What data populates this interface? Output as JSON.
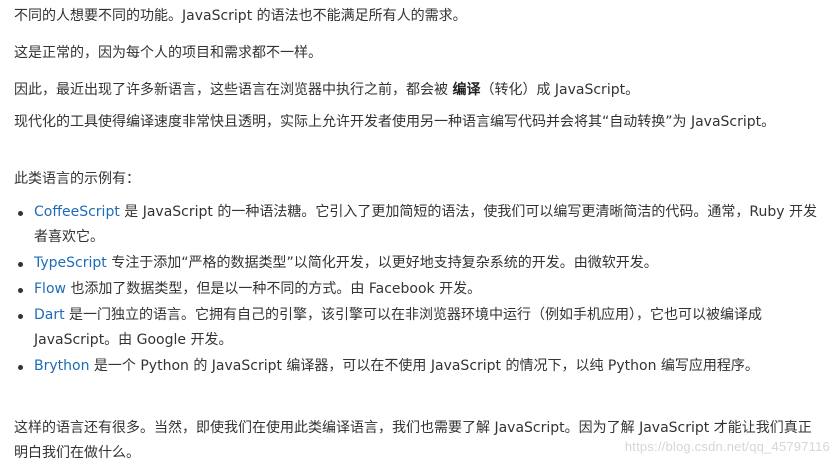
{
  "paragraphs": {
    "p1": "不同的人想要不同的功能。JavaScript 的语法也不能满足所有人的需求。",
    "p2": "这是正常的，因为每个人的项目和需求都不一样。",
    "p3_before": "因此，最近出现了许多新语言，这些语言在浏览器中执行之前，都会被 ",
    "p3_bold": "编译",
    "p3_after": "（转化）成 JavaScript。",
    "p4": "现代化的工具使得编译速度非常快且透明，实际上允许开发者使用另一种语言编写代码并会将其“自动转换”为 JavaScript。",
    "p5": "此类语言的示例有：",
    "p6": "这样的语言还有很多。当然，即使我们在使用此类编译语言，我们也需要了解 JavaScript。因为了解 JavaScript 才能让我们真正明白我们在做什么。"
  },
  "languages": [
    {
      "name": "CoffeeScript",
      "desc": " 是 JavaScript 的一种语法糖。它引入了更加简短的语法，使我们可以编写更清晰简洁的代码。通常，Ruby 开发者喜欢它。"
    },
    {
      "name": "TypeScript",
      "desc": " 专注于添加“严格的数据类型”以简化开发，以更好地支持复杂系统的开发。由微软开发。"
    },
    {
      "name": "Flow",
      "desc": " 也添加了数据类型，但是以一种不同的方式。由 Facebook 开发。"
    },
    {
      "name": "Dart",
      "desc": " 是一门独立的语言。它拥有自己的引擎，该引擎可以在非浏览器环境中运行（例如手机应用），它也可以被编译成 JavaScript。由 Google 开发。"
    },
    {
      "name": "Brython",
      "desc": " 是一个 Python 的 JavaScript 编译器，可以在不使用 JavaScript 的情况下，以纯 Python 编写应用程序。"
    }
  ],
  "watermark": "https://blog.csdn.net/qq_45797116",
  "colors": {
    "text": "#333333",
    "link": "#1e6bb8",
    "watermark": "#d6d6d6"
  }
}
